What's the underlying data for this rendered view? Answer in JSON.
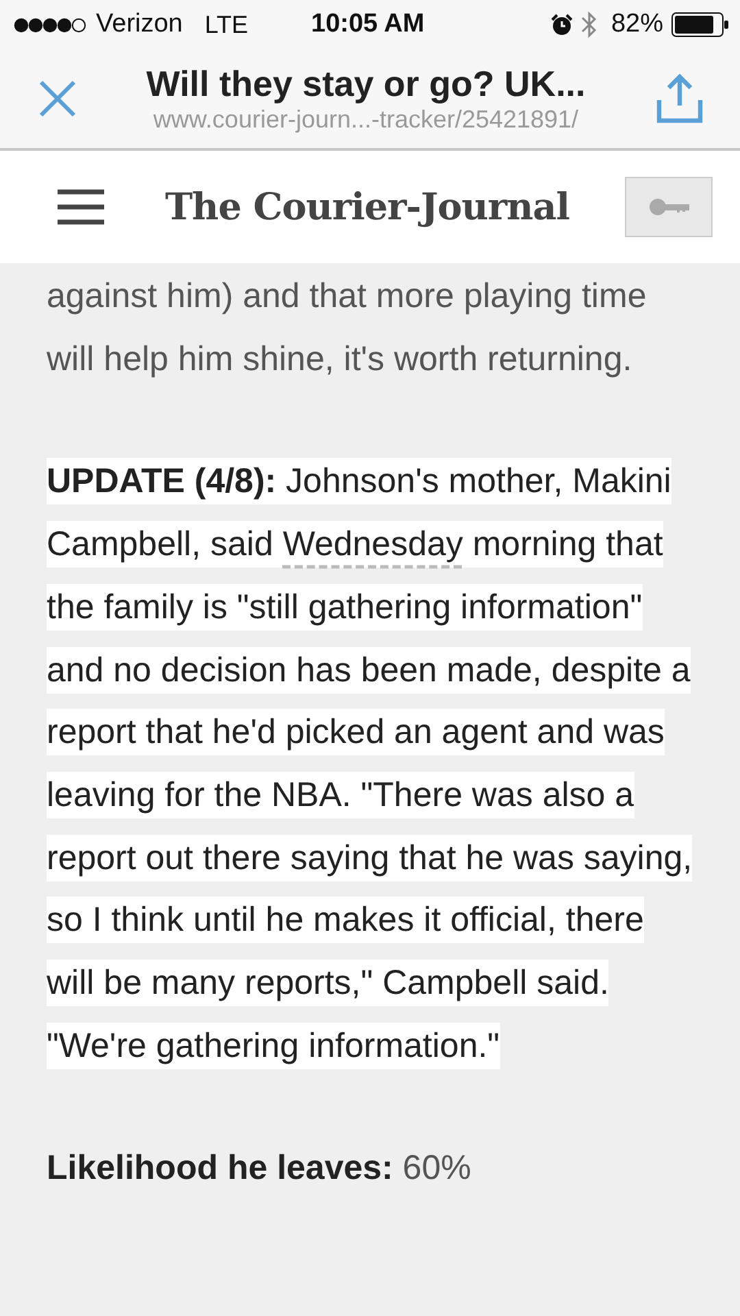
{
  "status_bar": {
    "carrier": "Verizon",
    "network": "LTE",
    "time": "10:05 AM",
    "battery": "82%"
  },
  "browser_bar": {
    "title": "Will they stay or go? UK...",
    "url": "www.courier-journ...-tracker/25421891/"
  },
  "site_header": {
    "logo": "The Courier-Journal"
  },
  "article": {
    "paragraphs": [
      {
        "highlighted": false,
        "text": "against him) and that more playing time will help him shine, it's worth returning."
      },
      {
        "highlighted": true,
        "text": "**UPDATE (4/8):** Johnson's mother, Makini Campbell, said",
        "link": "Wednesday",
        "text_after": "morning that the family is \"still gathering information\" and no decision has been made, despite a report that he'd picked an agent and was leaving for the NBA. \"There was also a report out there saying that he was saying, so I think until he makes it official, there will be many reports,\" Campbell said. \"We're gathering information.\""
      },
      {
        "highlighted": false,
        "text": "**Likelihood he leaves:** 60%"
      }
    ]
  }
}
